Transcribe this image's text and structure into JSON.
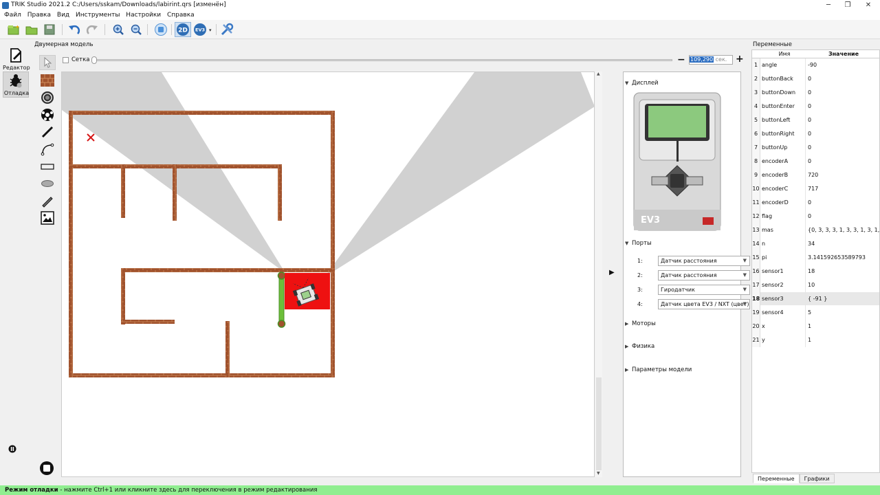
{
  "window": {
    "title": "TRIK Studio 2021.2 C:/Users/sskam/Downloads/labirint.qrs [изменён]",
    "controls": [
      "─",
      "❐",
      "✕"
    ]
  },
  "menu": [
    "Файл",
    "Правка",
    "Вид",
    "Инструменты",
    "Настройки",
    "Справка"
  ],
  "toolbar": {
    "icons": [
      "new-project-icon",
      "open-project-icon",
      "save-icon",
      "undo-icon",
      "redo-icon",
      "zoom-in-icon",
      "zoom-out-icon",
      "stop-robot-icon",
      "2d-mode-icon",
      "ev3-icon",
      "robot-settings-icon"
    ],
    "btn_2d": "2D",
    "btn_ev3": "EV3"
  },
  "left_dock": {
    "editor_label": "Редактор",
    "debug_label": "Отладка"
  },
  "model": {
    "title": "Двумерная модель",
    "grid_label": "Сетка",
    "time_value": "109,290",
    "time_unit": "сек.",
    "zoom_minus": "−",
    "zoom_plus": "+"
  },
  "palette": [
    "cursor-icon",
    "wall-icon",
    "skittle-icon",
    "ball-icon",
    "line-icon",
    "bezier-icon",
    "rectangle-icon",
    "ellipse-icon",
    "pencil-icon",
    "image-icon"
  ],
  "device_panel": {
    "display_label": "Дисплей",
    "brick_label": "EV3",
    "ports_label": "Порты",
    "ports": [
      {
        "num": "1:",
        "value": "Датчик расстояния"
      },
      {
        "num": "2:",
        "value": "Датчик расстояния"
      },
      {
        "num": "3:",
        "value": "Гиродатчик"
      },
      {
        "num": "4:",
        "value": "Датчик цвета EV3 / NXT (цвет)"
      }
    ],
    "motors_label": "Моторы",
    "physics_label": "Физика",
    "model_params_label": "Параметры модели",
    "collapse_arrow": "▶"
  },
  "variables": {
    "title": "Переменные",
    "col_name": "Имя",
    "col_value": "Значение",
    "rows": [
      {
        "idx": "1",
        "name": "angle",
        "value": "-90"
      },
      {
        "idx": "2",
        "name": "buttonBack",
        "value": "0"
      },
      {
        "idx": "3",
        "name": "buttonDown",
        "value": "0"
      },
      {
        "idx": "4",
        "name": "buttonEnter",
        "value": "0"
      },
      {
        "idx": "5",
        "name": "buttonLeft",
        "value": "0"
      },
      {
        "idx": "6",
        "name": "buttonRight",
        "value": "0"
      },
      {
        "idx": "7",
        "name": "buttonUp",
        "value": "0"
      },
      {
        "idx": "8",
        "name": "encoderA",
        "value": "0"
      },
      {
        "idx": "9",
        "name": "encoderB",
        "value": "720"
      },
      {
        "idx": "10",
        "name": "encoderC",
        "value": "717"
      },
      {
        "idx": "11",
        "name": "encoderD",
        "value": "0"
      },
      {
        "idx": "12",
        "name": "flag",
        "value": "0"
      },
      {
        "idx": "13",
        "name": "mas",
        "value": "{0, 3, 3, 3, 1, 3, 3, 1, 3, 1, 3,"
      },
      {
        "idx": "14",
        "name": "n",
        "value": "34"
      },
      {
        "idx": "15",
        "name": "pi",
        "value": "3.141592653589793"
      },
      {
        "idx": "16",
        "name": "sensor1",
        "value": "18"
      },
      {
        "idx": "17",
        "name": "sensor2",
        "value": "10"
      },
      {
        "idx": "18",
        "name": "sensor3",
        "value": "{ -91 }"
      },
      {
        "idx": "19",
        "name": "sensor4",
        "value": "5"
      },
      {
        "idx": "20",
        "name": "x",
        "value": "1"
      },
      {
        "idx": "21",
        "name": "y",
        "value": "1"
      }
    ],
    "selected_row": "18",
    "tab_variables": "Переменные",
    "tab_graphs": "Графики"
  },
  "status": {
    "mode": "Режим отладки",
    "hint": " - нажмите Ctrl+1 или кликните здесь для переключения в режим редактирования"
  },
  "colors": {
    "status_bg": "#90ee90",
    "wall": "#a0522d",
    "robot_zone": "#ee1111",
    "ev3_screen": "#8cc97e",
    "sensor_beam": "#cccccc"
  }
}
